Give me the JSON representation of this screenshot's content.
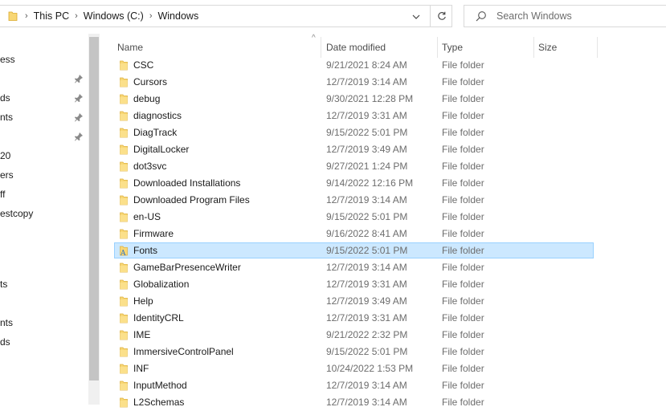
{
  "address_bar": {
    "crumbs": [
      "This PC",
      "Windows (C:)",
      "Windows"
    ]
  },
  "search": {
    "placeholder": "Search Windows"
  },
  "nav_pane": {
    "items": [
      {
        "label": "ess",
        "pinned": false
      },
      {
        "label": "",
        "pinned": true
      },
      {
        "label": "ds",
        "pinned": true
      },
      {
        "label": "nts",
        "pinned": true
      },
      {
        "label": "",
        "pinned": true
      },
      {
        "label": "20",
        "pinned": false
      },
      {
        "label": "ers",
        "pinned": false
      },
      {
        "label": "ff",
        "pinned": false
      },
      {
        "label": "estcopy",
        "pinned": false
      },
      {
        "label": "",
        "pinned": false
      },
      {
        "label": "",
        "pinned": false
      },
      {
        "label": "ts",
        "pinned": false
      },
      {
        "label": "",
        "pinned": false
      },
      {
        "label": "nts",
        "pinned": false
      },
      {
        "label": "ds",
        "pinned": false
      }
    ]
  },
  "columns": {
    "name": "Name",
    "date_modified": "Date modified",
    "type": "Type",
    "size": "Size"
  },
  "files": [
    {
      "name": "CSC",
      "date": "9/21/2021 8:24 AM",
      "type": "File folder"
    },
    {
      "name": "Cursors",
      "date": "12/7/2019 3:14 AM",
      "type": "File folder"
    },
    {
      "name": "debug",
      "date": "9/30/2021 12:28 PM",
      "type": "File folder"
    },
    {
      "name": "diagnostics",
      "date": "12/7/2019 3:31 AM",
      "type": "File folder"
    },
    {
      "name": "DiagTrack",
      "date": "9/15/2022 5:01 PM",
      "type": "File folder"
    },
    {
      "name": "DigitalLocker",
      "date": "12/7/2019 3:49 AM",
      "type": "File folder"
    },
    {
      "name": "dot3svc",
      "date": "9/27/2021 1:24 PM",
      "type": "File folder"
    },
    {
      "name": "Downloaded Installations",
      "date": "9/14/2022 12:16 PM",
      "type": "File folder"
    },
    {
      "name": "Downloaded Program Files",
      "date": "12/7/2019 3:14 AM",
      "type": "File folder"
    },
    {
      "name": "en-US",
      "date": "9/15/2022 5:01 PM",
      "type": "File folder"
    },
    {
      "name": "Firmware",
      "date": "9/16/2022 8:41 AM",
      "type": "File folder"
    },
    {
      "name": "Fonts",
      "date": "9/15/2022 5:01 PM",
      "type": "File folder",
      "selected": true,
      "icon": "fonts-folder-icon"
    },
    {
      "name": "GameBarPresenceWriter",
      "date": "12/7/2019 3:14 AM",
      "type": "File folder"
    },
    {
      "name": "Globalization",
      "date": "12/7/2019 3:31 AM",
      "type": "File folder"
    },
    {
      "name": "Help",
      "date": "12/7/2019 3:49 AM",
      "type": "File folder"
    },
    {
      "name": "IdentityCRL",
      "date": "12/7/2019 3:31 AM",
      "type": "File folder"
    },
    {
      "name": "IME",
      "date": "9/21/2022 2:32 PM",
      "type": "File folder"
    },
    {
      "name": "ImmersiveControlPanel",
      "date": "9/15/2022 5:01 PM",
      "type": "File folder"
    },
    {
      "name": "INF",
      "date": "10/24/2022 1:53 PM",
      "type": "File folder"
    },
    {
      "name": "InputMethod",
      "date": "12/7/2019 3:14 AM",
      "type": "File folder"
    },
    {
      "name": "L2Schemas",
      "date": "12/7/2019 3:14 AM",
      "type": "File folder"
    }
  ],
  "colors": {
    "selection_bg": "#cce8ff",
    "selection_border": "#99d1ff",
    "folder_yellow": "#f8d775"
  }
}
